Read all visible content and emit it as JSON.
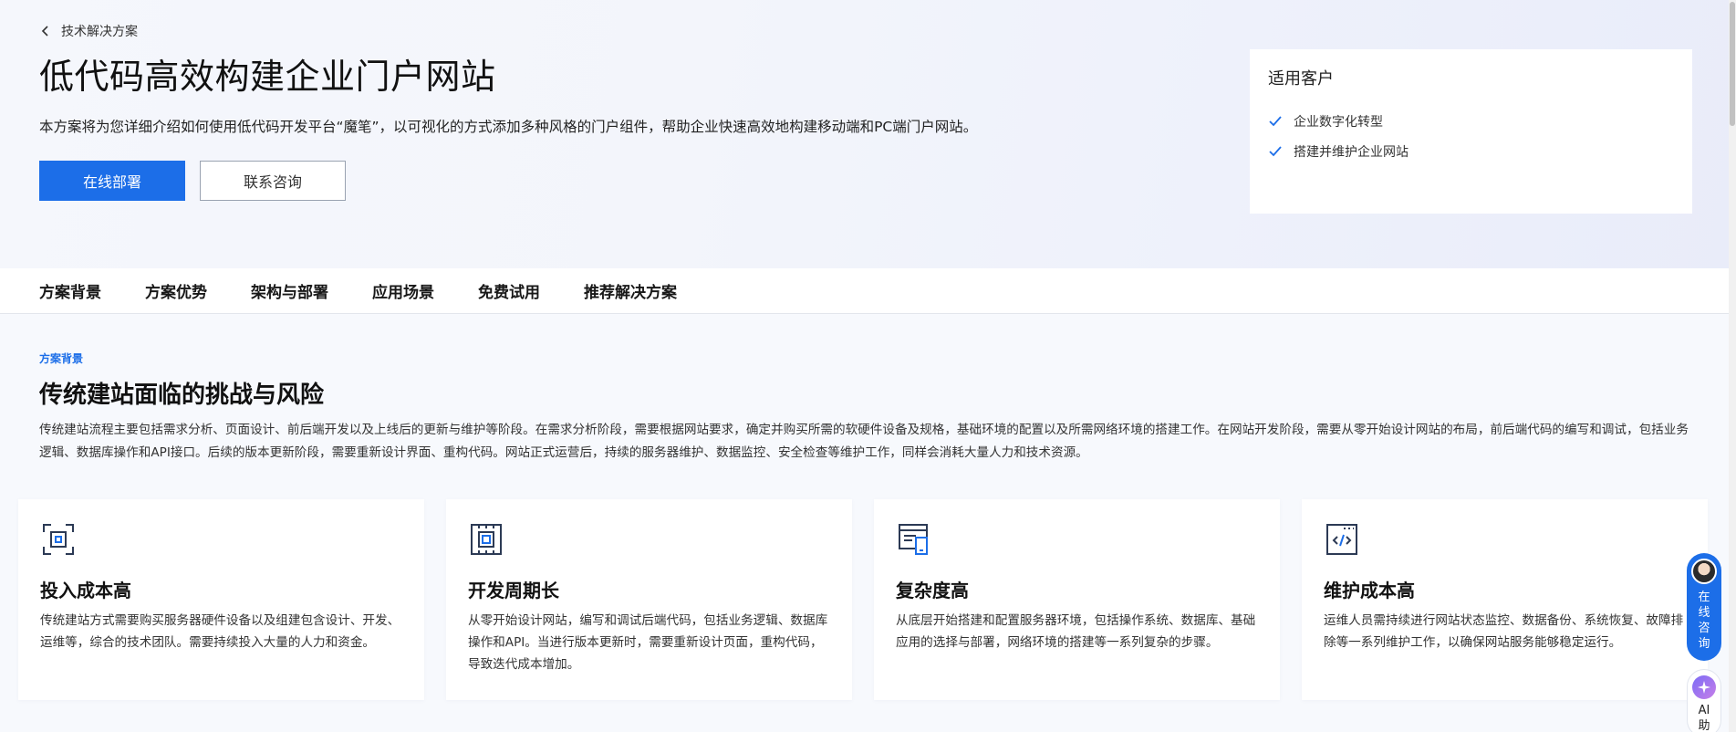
{
  "breadcrumb": {
    "label": "技术解决方案"
  },
  "hero": {
    "title": "低代码高效构建企业门户网站",
    "description": "本方案将为您详细介绍如何使用低代码开发平台“魔笔”，以可视化的方式添加多种风格的门户组件，帮助企业快速高效地构建移动端和PC端门户网站。",
    "primary_button": "在线部署",
    "secondary_button": "联系咨询"
  },
  "customers": {
    "title": "适用客户",
    "items": [
      "企业数字化转型",
      "搭建并维护企业网站"
    ]
  },
  "tabs": [
    "方案背景",
    "方案优势",
    "架构与部署",
    "应用场景",
    "免费试用",
    "推荐解决方案"
  ],
  "section": {
    "tag": "方案背景",
    "title": "传统建站面临的挑战与风险",
    "body": "传统建站流程主要包括需求分析、页面设计、前后端开发以及上线后的更新与维护等阶段。在需求分析阶段，需要根据网站要求，确定并购买所需的软硬件设备及规格，基础环境的配置以及所需网络环境的搭建工作。在网站开发阶段，需要从零开始设计网站的布局，前后端代码的编写和调试，包括业务逻辑、数据库操作和API接口。后续的版本更新阶段，需要重新设计界面、重构代码。网站正式运营后，持续的服务器维护、数据监控、安全检查等维护工作，同样会消耗大量人力和技术资源。"
  },
  "cards": [
    {
      "icon": "cost-icon",
      "title": "投入成本高",
      "text": "传统建站方式需要购买服务器硬件设备以及组建包含设计、开发、运维等，综合的技术团队。需要持续投入大量的人力和资金。"
    },
    {
      "icon": "cycle-icon",
      "title": "开发周期长",
      "text": "从零开始设计网站，编写和调试后端代码，包括业务逻辑、数据库操作和API。当进行版本更新时，需要重新设计页面，重构代码，导致迭代成本增加。"
    },
    {
      "icon": "complexity-icon",
      "title": "复杂度高",
      "text": "从底层开始搭建和配置服务器环境，包括操作系统、数据库、基础应用的选择与部署，网络环境的搭建等一系列复杂的步骤。"
    },
    {
      "icon": "code-icon",
      "title": "维护成本高",
      "text": "运维人员需持续进行网站状态监控、数据备份、系统恢复、故障排除等一系列维护工作，以确保网站服务能够稳定运行。"
    }
  ],
  "floating": {
    "consult_label": "在线咨询",
    "ai_label": "AI助"
  },
  "colors": {
    "accent": "#1c6ee8"
  }
}
